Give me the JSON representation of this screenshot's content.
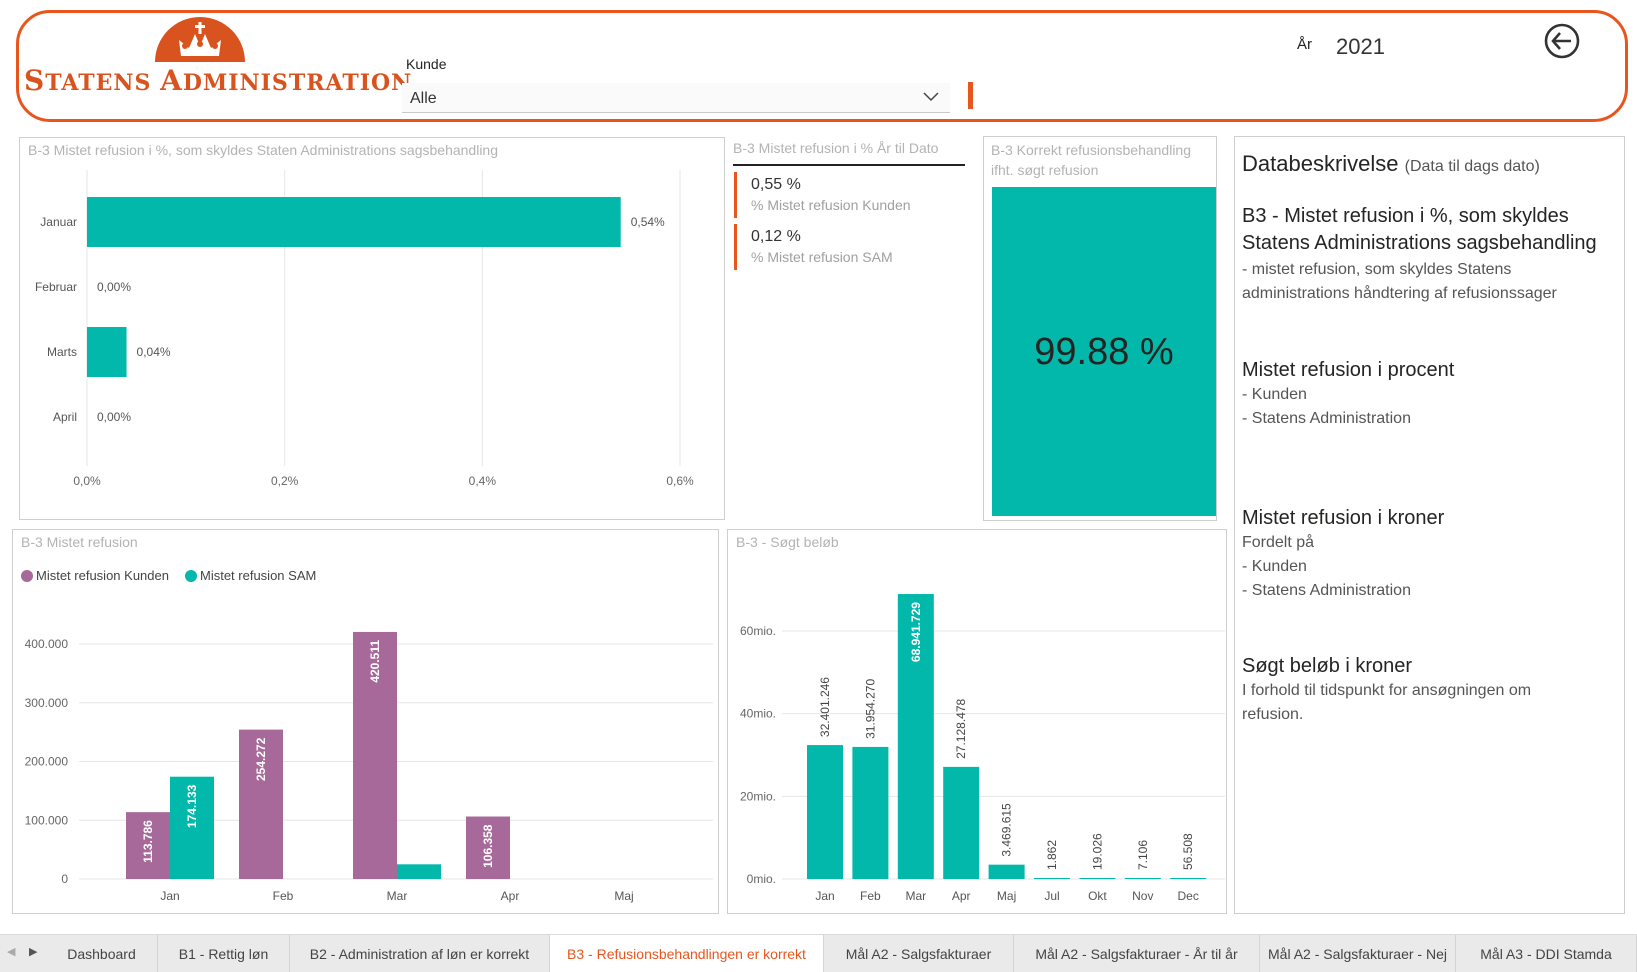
{
  "header": {
    "logo_text_prefix_1": "S",
    "logo_text_rest_1": "TATENS ",
    "logo_text_prefix_2": "A",
    "logo_text_rest_2": "DMINISTRATION",
    "kunde_label": "Kunde",
    "kunde_value": "Alle",
    "ar_label": "År",
    "ar_value": "2021",
    "brand_color": "#e8561e"
  },
  "pct_chart": {
    "title": "B-3 Mistet refusion i %, som skyldes Staten Administrations sagsbehandling",
    "chart_data": {
      "type": "bar",
      "orientation": "horizontal",
      "categories": [
        "Januar",
        "Februar",
        "Marts",
        "April"
      ],
      "values": [
        0.54,
        0.0,
        0.04,
        0.0
      ],
      "value_labels": [
        "0,54%",
        "0,00%",
        "0,04%",
        "0,00%"
      ],
      "xticks": [
        "0,0%",
        "0,2%",
        "0,4%",
        "0,6%"
      ],
      "xlim": [
        0,
        0.6
      ],
      "grid": true,
      "color": "#01b8aa"
    }
  },
  "kpi": {
    "title": "B-3 Mistet refusion i % År til Dato",
    "items": [
      {
        "value": "0,55 %",
        "label": "% Mistet refusion Kunden"
      },
      {
        "value": "0,12 %",
        "label": "% Mistet refusion SAM"
      }
    ]
  },
  "correct": {
    "title": "B-3 Korrekt refusionsbehandling ifht. søgt refusion",
    "value": "99.88 %",
    "color": "#01b8aa"
  },
  "lost_chart": {
    "title": "B-3 Mistet refusion",
    "legend": [
      "Mistet refusion Kunden",
      "Mistet refusion SAM"
    ],
    "chart_data": {
      "type": "bar",
      "categories": [
        "Jan",
        "Feb",
        "Mar",
        "Apr",
        "Maj"
      ],
      "series": [
        {
          "name": "Mistet refusion Kunden",
          "color": "#a66999",
          "values": [
            113786,
            254272,
            420511,
            106358,
            null
          ],
          "labels": [
            "113.786",
            "254.272",
            "420.511",
            "106.358",
            ""
          ]
        },
        {
          "name": "Mistet refusion SAM",
          "color": "#01b8aa",
          "values": [
            174133,
            0,
            25000,
            0,
            null
          ],
          "labels": [
            "174.133",
            "",
            "",
            "",
            ""
          ]
        }
      ],
      "yticks": [
        "0",
        "100.000",
        "200.000",
        "300.000",
        "400.000"
      ],
      "ylim": [
        0,
        400000
      ],
      "grid": true,
      "legend_position": "top-left"
    }
  },
  "sought_chart": {
    "title": "B-3 - Søgt beløb",
    "chart_data": {
      "type": "bar",
      "categories": [
        "Jan",
        "Feb",
        "Mar",
        "Apr",
        "Maj",
        "Jul",
        "Okt",
        "Nov",
        "Dec"
      ],
      "values": [
        32401246,
        31954270,
        68941729,
        27128478,
        3469615,
        1862,
        19026,
        7106,
        56508
      ],
      "value_labels": [
        "32.401.246",
        "31.954.270",
        "68.941.729",
        "27.128.478",
        "3.469.615",
        "1.862",
        "19.026",
        "7.106",
        "56.508"
      ],
      "yticks": [
        "0mio.",
        "20mio.",
        "40mio.",
        "60mio."
      ],
      "ylim": [
        0,
        60000000
      ],
      "grid": true,
      "color": "#01b8aa"
    }
  },
  "description": {
    "title": "Databeskrivelse",
    "title_note": "(Data til dags dato)",
    "sections": [
      {
        "heading_1": "B3 - Mistet refusion i %, som skyldes",
        "heading_2": "Statens Administrations sagsbehandling",
        "line_1": "- mistet refusion, som skyldes Statens",
        "line_2": "administrations håndtering af refusionssager"
      },
      {
        "heading": "Mistet refusion i procent",
        "line_1": "- Kunden",
        "line_2": "- Statens Administration"
      },
      {
        "heading": "Mistet refusion i kroner",
        "line_0": "Fordelt på",
        "line_1": "- Kunden",
        "line_2": "- Statens Administration"
      },
      {
        "heading": "Søgt beløb i kroner",
        "line_1": "I forhold til tidspunkt for ansøgningen om",
        "line_2": "refusion."
      }
    ]
  },
  "tabs": [
    {
      "label": "Dashboard",
      "active": false
    },
    {
      "label": "B1 - Rettig løn",
      "active": false
    },
    {
      "label": "B2 - Administration af løn er korrekt",
      "active": false
    },
    {
      "label": "B3 - Refusionsbehandlingen er korrekt",
      "active": true
    },
    {
      "label": "Mål A2 - Salgsfakturaer",
      "active": false
    },
    {
      "label": "Mål A2 - Salgsfakturaer - År til år",
      "active": false
    },
    {
      "label": "Mål A2 - Salgsfakturaer - Nej",
      "active": false
    },
    {
      "label": "Mål A3 - DDI Stamda",
      "active": false
    }
  ]
}
